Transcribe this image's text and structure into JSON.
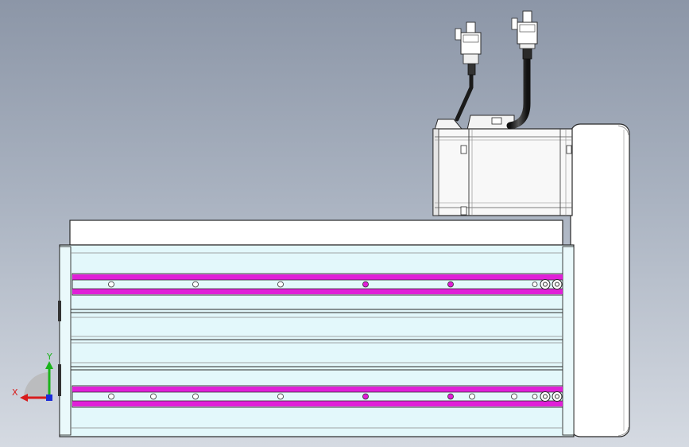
{
  "viewport": {
    "name": "cad-viewport-side-view",
    "background_top": "#8c96a7",
    "background_bottom": "#d5dae2"
  },
  "triad": {
    "x_label": "X",
    "y_label": "Y",
    "x_color": "#d81b1b",
    "y_color": "#1bb31b",
    "z_color": "#1b2bd8"
  },
  "model": {
    "accent_slot_color": "#e020d8",
    "body_fill": "#e3f8fb",
    "line_color": "#2a2a2a",
    "parts": [
      "linear-module-body",
      "servo-motor",
      "motor-cover",
      "motor-cables",
      "cable-connectors",
      "slot-rails",
      "end-cap"
    ]
  }
}
